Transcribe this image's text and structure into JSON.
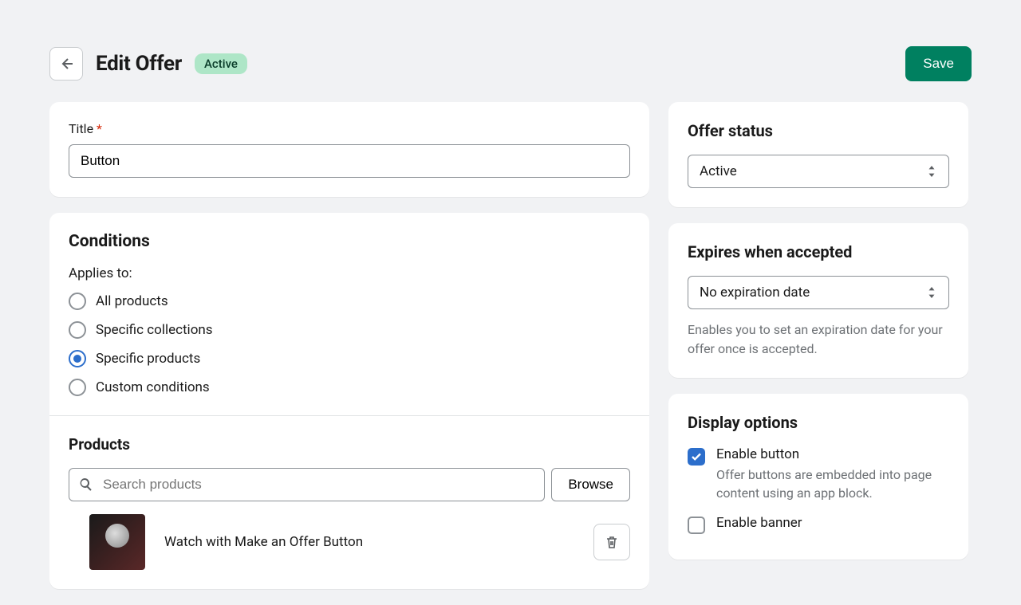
{
  "header": {
    "title": "Edit Offer",
    "badge": "Active",
    "save_label": "Save"
  },
  "title_card": {
    "label": "Title",
    "value": "Button"
  },
  "conditions": {
    "heading": "Conditions",
    "applies_label": "Applies to:",
    "options": [
      "All products",
      "Specific collections",
      "Specific products",
      "Custom conditions"
    ],
    "selected_index": 2
  },
  "products": {
    "heading": "Products",
    "search_placeholder": "Search products",
    "browse_label": "Browse",
    "items": [
      {
        "name": "Watch with Make an Offer Button"
      }
    ]
  },
  "status": {
    "heading": "Offer status",
    "value": "Active"
  },
  "expires": {
    "heading": "Expires when accepted",
    "value": "No expiration date",
    "help": "Enables you to set an expiration date for your offer once is accepted."
  },
  "display": {
    "heading": "Display options",
    "enable_button": {
      "label": "Enable button",
      "desc": "Offer buttons are embedded into page content using an app block.",
      "checked": true
    },
    "enable_banner": {
      "label": "Enable banner",
      "checked": false
    }
  }
}
